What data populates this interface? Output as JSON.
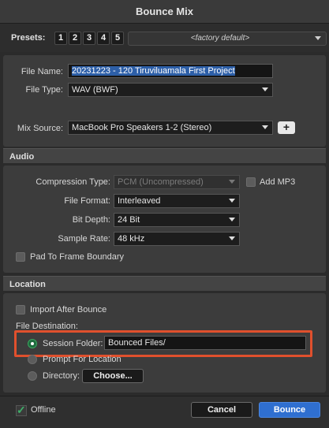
{
  "window": {
    "title": "Bounce Mix"
  },
  "presets": {
    "label": "Presets:",
    "buttons": [
      "1",
      "2",
      "3",
      "4",
      "5"
    ],
    "selected": "<factory default>"
  },
  "file": {
    "name_label": "File Name:",
    "name_value": "20231223 - 120 Tiruviluamala First Project",
    "type_label": "File Type:",
    "type_value": "WAV (BWF)",
    "mix_source_label": "Mix Source:",
    "mix_source_value": "MacBook Pro Speakers 1-2 (Stereo)",
    "add_label": "+"
  },
  "audio": {
    "heading": "Audio",
    "compression_label": "Compression Type:",
    "compression_value": "PCM (Uncompressed)",
    "add_mp3_label": "Add MP3",
    "format_label": "File Format:",
    "format_value": "Interleaved",
    "bit_depth_label": "Bit Depth:",
    "bit_depth_value": "24 Bit",
    "sample_rate_label": "Sample Rate:",
    "sample_rate_value": "48 kHz",
    "pad_label": "Pad To Frame Boundary"
  },
  "location": {
    "heading": "Location",
    "import_label": "Import After Bounce",
    "destination_label": "File Destination:",
    "session_folder_label": "Session Folder:",
    "session_folder_value": "Bounced Files/",
    "prompt_label": "Prompt For Location",
    "directory_label": "Directory:",
    "choose_label": "Choose..."
  },
  "footer": {
    "offline_label": "Offline",
    "cancel_label": "Cancel",
    "bounce_label": "Bounce"
  },
  "colors": {
    "accent": "#2f6fd0",
    "highlight_box": "#e0502d",
    "radio_on": "#3aa55e"
  }
}
